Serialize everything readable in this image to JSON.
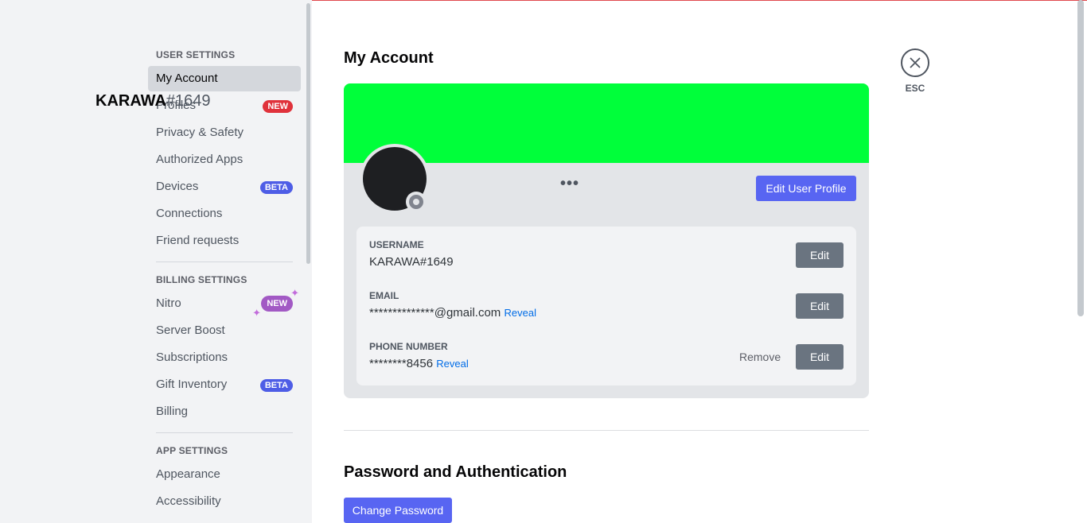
{
  "sidebar": {
    "headers": [
      "USER SETTINGS",
      "BILLING SETTINGS",
      "APP SETTINGS"
    ],
    "user_items": [
      {
        "label": "My Account",
        "badge": ""
      },
      {
        "label": "Profiles",
        "badge": "NEW"
      },
      {
        "label": "Privacy & Safety",
        "badge": ""
      },
      {
        "label": "Authorized Apps",
        "badge": ""
      },
      {
        "label": "Devices",
        "badge": "BETA"
      },
      {
        "label": "Connections",
        "badge": ""
      },
      {
        "label": "Friend requests",
        "badge": ""
      }
    ],
    "billing_items": [
      {
        "label": "Nitro",
        "badge": "NEW"
      },
      {
        "label": "Server Boost",
        "badge": ""
      },
      {
        "label": "Subscriptions",
        "badge": ""
      },
      {
        "label": "Gift Inventory",
        "badge": "BETA"
      },
      {
        "label": "Billing",
        "badge": ""
      }
    ],
    "app_items": [
      {
        "label": "Appearance"
      },
      {
        "label": "Accessibility"
      }
    ]
  },
  "main": {
    "title": "My Account",
    "banner_color": "#00ff3a",
    "username": "KARAWA",
    "discriminator": "#1649",
    "more_icon": "•••",
    "edit_profile_label": "Edit User Profile",
    "fields": {
      "username": {
        "label": "USERNAME",
        "value": "KARAWA#1649",
        "edit_label": "Edit"
      },
      "email": {
        "label": "EMAIL",
        "value": "**************@gmail.com",
        "reveal_label": "Reveal",
        "edit_label": "Edit"
      },
      "phone": {
        "label": "PHONE NUMBER",
        "value": "********8456",
        "reveal_label": "Reveal",
        "remove_label": "Remove",
        "edit_label": "Edit"
      }
    },
    "password_section_title": "Password and Authentication",
    "change_password_label": "Change Password"
  },
  "close": {
    "esc_label": "ESC",
    "icon": "close-icon"
  },
  "colors": {
    "accent": "#5865f2",
    "badge_new": "#e0323b",
    "badge_beta": "#4e5de6"
  }
}
